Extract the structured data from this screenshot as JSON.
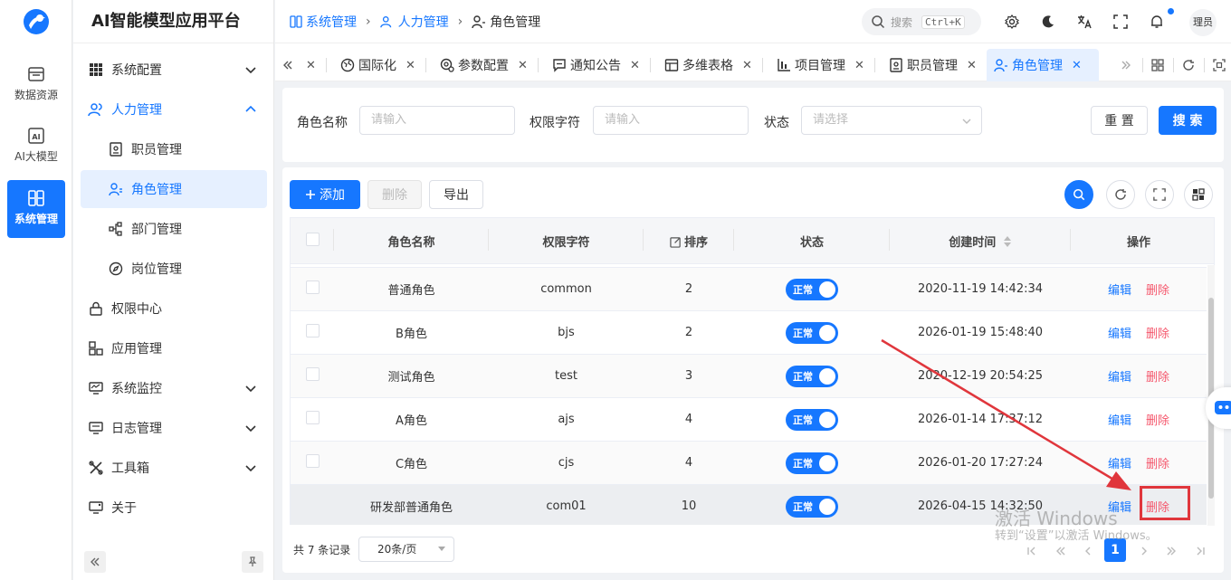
{
  "rail": {
    "items": [
      {
        "label": "数据资源"
      },
      {
        "label": "AI大模型"
      },
      {
        "label": "系统管理"
      }
    ]
  },
  "sidebar": {
    "brand": "AI智能模型应用平台",
    "items": [
      {
        "label": "系统配置"
      },
      {
        "label": "人力管理"
      },
      {
        "label": "职员管理"
      },
      {
        "label": "角色管理"
      },
      {
        "label": "部门管理"
      },
      {
        "label": "岗位管理"
      },
      {
        "label": "权限中心"
      },
      {
        "label": "应用管理"
      },
      {
        "label": "系统监控"
      },
      {
        "label": "日志管理"
      },
      {
        "label": "工具箱"
      },
      {
        "label": "关于"
      }
    ]
  },
  "header": {
    "breadcrumb": [
      "系统管理",
      "人力管理",
      "角色管理"
    ],
    "search_label": "搜索",
    "search_shortcut": "Ctrl+K",
    "avatar": "理员"
  },
  "tabs": [
    "国际化",
    "参数配置",
    "通知公告",
    "多维表格",
    "项目管理",
    "职员管理",
    "角色管理"
  ],
  "filter": {
    "role_name_label": "角色名称",
    "role_name_placeholder": "请输入",
    "perm_label": "权限字符",
    "perm_placeholder": "请输入",
    "status_label": "状态",
    "status_placeholder": "请选择",
    "reset": "重 置",
    "search": "搜 索"
  },
  "toolbar": {
    "add": "添加",
    "delete": "删除",
    "export": "导出"
  },
  "table": {
    "columns": [
      "角色名称",
      "权限字符",
      "排序",
      "状态",
      "创建时间",
      "操作"
    ],
    "status_on": "正常",
    "edit": "编辑",
    "delete": "删除",
    "rows": [
      {
        "name": "普通角色",
        "key": "common",
        "sort": "2",
        "created": "2020-11-19 14:42:34"
      },
      {
        "name": "B角色",
        "key": "bjs",
        "sort": "2",
        "created": "2026-01-19 15:48:40"
      },
      {
        "name": "测试角色",
        "key": "test",
        "sort": "3",
        "created": "2020-12-19 20:54:25"
      },
      {
        "name": "A角色",
        "key": "ajs",
        "sort": "4",
        "created": "2026-01-14 17:37:12"
      },
      {
        "name": "C角色",
        "key": "cjs",
        "sort": "4",
        "created": "2026-01-20 17:27:24"
      },
      {
        "name": "研发部普通角色",
        "key": "com01",
        "sort": "10",
        "created": "2026-04-15 14:32:50"
      }
    ]
  },
  "pager": {
    "total": "共 7 条记录",
    "size": "20条/页",
    "current": "1"
  },
  "watermark": {
    "line1": "激活 Windows",
    "line2": "转到“设置”以激活 Windows。"
  },
  "colors": {
    "primary": "#1677ff",
    "danger": "#f5576c",
    "annotation": "#e0363c"
  }
}
